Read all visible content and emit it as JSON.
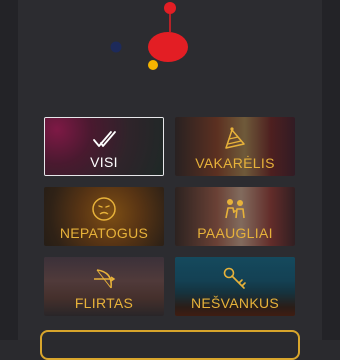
{
  "logo": {
    "colors": {
      "red": "#e31e24",
      "yellow": "#f4b400",
      "navy": "#1d2a5a"
    }
  },
  "categories": [
    {
      "label": "VISI",
      "icon": "double-check-icon",
      "selected": true,
      "label_color": "#ffffff"
    },
    {
      "label": "VAKARĖLIS",
      "icon": "party-hat-icon",
      "selected": false,
      "label_color": "#e7b23a"
    },
    {
      "label": "NEPATOGUS",
      "icon": "awkward-face-icon",
      "selected": false,
      "label_color": "#e7b23a"
    },
    {
      "label": "PAAUGLIAI",
      "icon": "teens-icon",
      "selected": false,
      "label_color": "#e7b23a"
    },
    {
      "label": "FLIRTAS",
      "icon": "cupid-bow-icon",
      "selected": false,
      "label_color": "#e7b23a"
    },
    {
      "label": "NEŠVANKUS",
      "icon": "key-icon",
      "selected": false,
      "label_color": "#e7b23a"
    }
  ],
  "accent": "#d9a62c"
}
